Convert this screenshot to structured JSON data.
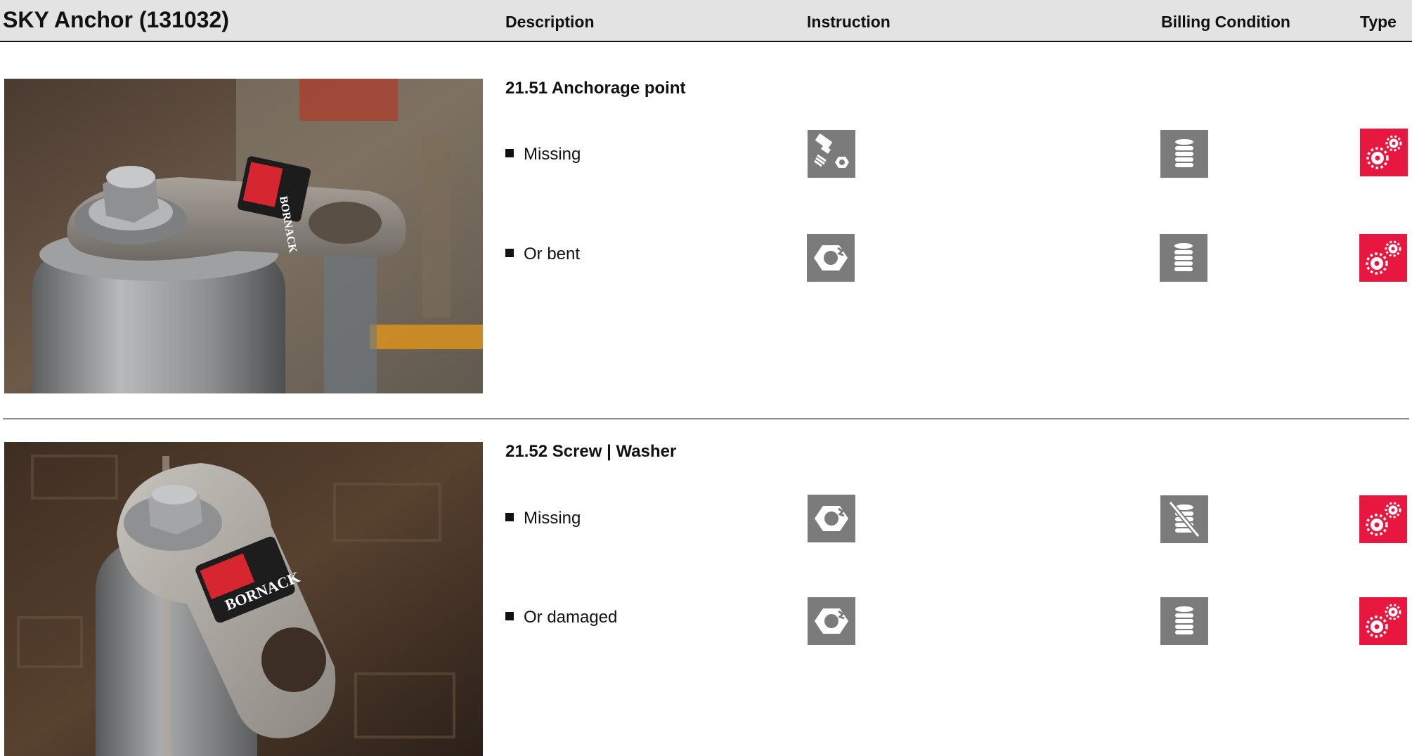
{
  "header": {
    "title": "SKY Anchor (131032)",
    "col_description": "Description",
    "col_instruction": "Instruction",
    "col_billing": "Billing Condition",
    "col_type": "Type"
  },
  "colors": {
    "header_bg": "#e3e3e3",
    "icon_gray": "#7b7b7b",
    "type_red": "#e8173f"
  },
  "sections": [
    {
      "title": "21.51 Anchorage point",
      "image_label": "BORNACK",
      "items": [
        {
          "text": "Missing",
          "instruction_icon": "bolt-nut-icon",
          "billing_icon": "coin-stack-icon",
          "type_icon": "gears-icon"
        },
        {
          "text": "Or bent",
          "instruction_icon": "nut-icon",
          "billing_icon": "coin-stack-icon",
          "type_icon": "gears-icon"
        }
      ]
    },
    {
      "title": "21.52 Screw | Washer",
      "image_label": "BORNACK",
      "items": [
        {
          "text": "Missing",
          "instruction_icon": "nut-icon",
          "billing_icon": "coin-stack-crossed-icon",
          "type_icon": "gears-icon"
        },
        {
          "text": "Or damaged",
          "instruction_icon": "nut-icon",
          "billing_icon": "coin-stack-icon",
          "type_icon": "gears-icon"
        }
      ]
    }
  ]
}
